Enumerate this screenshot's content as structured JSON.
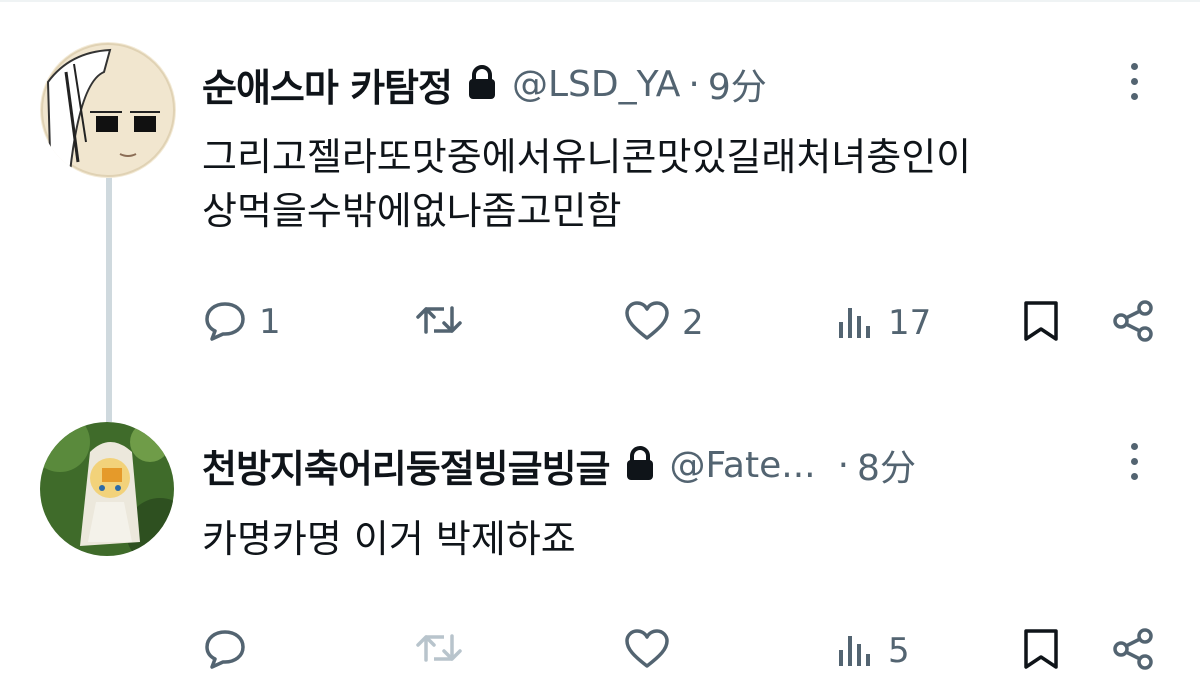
{
  "colors": {
    "text": "#0f1419",
    "secondary": "#536471",
    "thread_line": "#cfd9de",
    "divider": "#eff3f4"
  },
  "tweets": [
    {
      "display_name": "순애스마 카탐정",
      "handle": "@LSD_YA",
      "separator": "·",
      "time": "9分",
      "text_lines": [
        "그리고젤라또맛중에서유니콘맛있길래처녀충인이",
        "상먹을수밖에없나좀고민함"
      ],
      "reply_count": "1",
      "retweet_count": "",
      "like_count": "2",
      "view_count": "17",
      "icons": [
        "reply-icon",
        "retweet-icon",
        "like-icon",
        "views-icon",
        "bookmark-icon",
        "share-icon"
      ]
    },
    {
      "display_name": "천방지축어리둥절빙글빙글",
      "handle": "@Fate...",
      "separator": "·",
      "time": "8分",
      "text_lines": [
        "카명카명 이거 박제하죠"
      ],
      "reply_count": "",
      "retweet_count": "",
      "like_count": "",
      "view_count": "5",
      "icons": [
        "reply-icon",
        "retweet-icon",
        "like-icon",
        "views-icon",
        "bookmark-icon",
        "share-icon"
      ]
    }
  ]
}
